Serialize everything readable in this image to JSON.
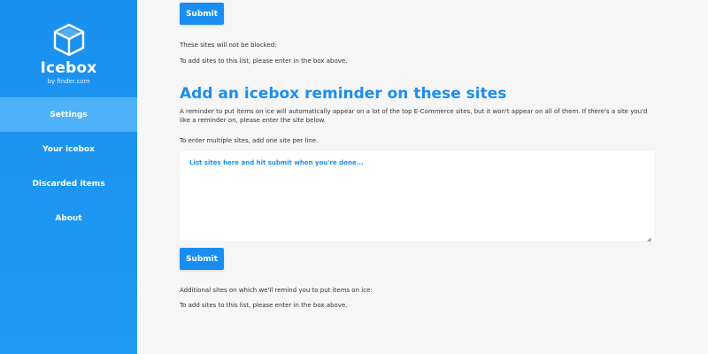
{
  "sidebar": {
    "brand": "Icebox",
    "brand_sub": "by finder.com",
    "logo_icon": "cube-icon",
    "items": [
      {
        "label": "Settings",
        "active": true
      },
      {
        "label": "Your icebox",
        "active": false
      },
      {
        "label": "Discarded items",
        "active": false
      },
      {
        "label": "About",
        "active": false
      }
    ]
  },
  "main": {
    "top_submit_label": "Submit",
    "blocked_label": "These sites will not be blocked:",
    "blocked_hint": "To add sites to this list, please enter in the box above.",
    "reminder_heading": "Add an icebox reminder on these sites",
    "reminder_description": "A reminder to put items on ice will automatically appear on a lot of the top E-Commerce sites, but it won't appear on all of them. If there's a site you'd like a reminder on, please enter the site below.",
    "multi_hint": "To enter multiple sites, add one site per line.",
    "sites_placeholder": "List sites here and hit submit when you're done...",
    "sites_value": "",
    "bottom_submit_label": "Submit",
    "additional_label": "Additional sites on which we'll remind you to put items on ice:",
    "additional_hint": "To add sites to this list, please enter in the box above."
  },
  "colors": {
    "accent": "#1a8ef0",
    "sidebar_active": "#4eb2fb",
    "background": "#f6f6f6"
  }
}
